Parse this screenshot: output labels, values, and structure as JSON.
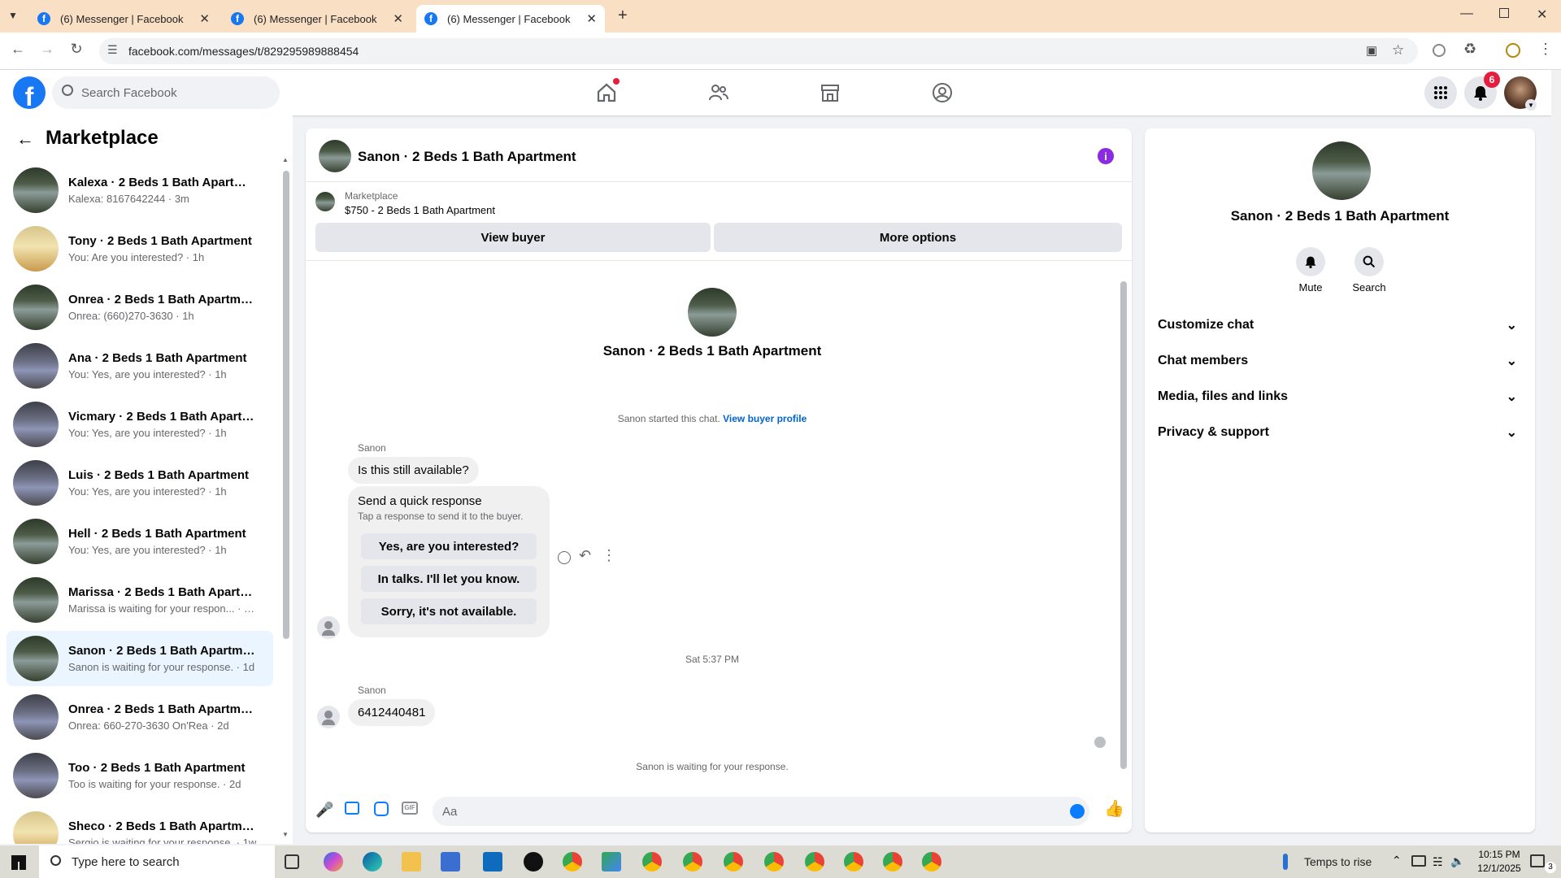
{
  "browser": {
    "tabs": [
      {
        "title": "(6) Messenger | Facebook"
      },
      {
        "title": "(6) Messenger | Facebook"
      },
      {
        "title": "(6) Messenger | Facebook"
      }
    ],
    "url": "facebook.com/messages/t/829295989888454"
  },
  "fb": {
    "search_placeholder": "Search Facebook",
    "notification_count": "6"
  },
  "left": {
    "title": "Marketplace",
    "conversations": [
      {
        "name": "Kalexa · 2 Beds 1 Bath Apartment",
        "sub": "Kalexa: 8167642244 · 3m",
        "img": "a"
      },
      {
        "name": "Tony · 2 Beds 1 Bath Apartment",
        "sub": "You: Are you interested? · 1h",
        "img": "b"
      },
      {
        "name": "Onrea · 2 Beds 1 Bath Apartment",
        "sub": "Onrea: (660)270-3630 · 1h",
        "img": "a"
      },
      {
        "name": "Ana · 2 Beds 1 Bath Apartment",
        "sub": "You: Yes, are you interested? · 1h",
        "img": "c"
      },
      {
        "name": "Vicmary · 2 Beds 1 Bath Apartm...",
        "sub": "You: Yes, are you interested? · 1h",
        "img": "c"
      },
      {
        "name": "Luis · 2 Beds 1 Bath Apartment",
        "sub": "You: Yes, are you interested? · 1h",
        "img": "c"
      },
      {
        "name": "Hell · 2 Beds 1 Bath Apartment",
        "sub": "You: Yes, are you interested? · 1h",
        "img": "a"
      },
      {
        "name": "Marissa · 2 Beds 1 Bath Apartment",
        "sub": "Marissa is waiting for your respon... · 15h",
        "img": "a"
      },
      {
        "name": "Sanon · 2 Beds 1 Bath Apartment",
        "sub": "Sanon is waiting for your response. · 1d",
        "img": "a"
      },
      {
        "name": "Onrea · 2 Beds 1 Bath Apartment",
        "sub": "Onrea: 660-270-3630 On'Rea · 2d",
        "img": "c"
      },
      {
        "name": "Too · 2 Beds 1 Bath Apartment",
        "sub": "Too is waiting for your response. · 2d",
        "img": "c"
      },
      {
        "name": "Sheco · 2 Beds 1 Bath Apartment",
        "sub": "Sergio is waiting for your response. · 1w",
        "img": "b"
      }
    ]
  },
  "chat": {
    "header_title": "Sanon · 2 Beds 1 Bath Apartment",
    "listing_source": "Marketplace",
    "listing_title": "$750 - 2 Beds 1 Bath Apartment",
    "view_buyer": "View buyer",
    "more_options": "More options",
    "profile_name": "Sanon · 2 Beds 1 Bath Apartment",
    "started_text": "Sanon started this chat.",
    "view_buyer_profile": "View buyer profile",
    "sender1": "Sanon",
    "msg1": "Is this still available?",
    "quick_title": "Send a quick response",
    "quick_sub": "Tap a response to send it to the buyer.",
    "quick_replies": [
      "Yes, are you interested?",
      "In talks. I'll let you know.",
      "Sorry, it's not available."
    ],
    "timestamp": "Sat 5:37 PM",
    "sender2": "Sanon",
    "msg2": "6412440481",
    "waiting": "Sanon is waiting for your response.",
    "composer_placeholder": "Aa"
  },
  "right": {
    "name": "Sanon · 2 Beds 1 Bath Apartment",
    "mute": "Mute",
    "search": "Search",
    "sections": [
      "Customize chat",
      "Chat members",
      "Media, files and links",
      "Privacy & support"
    ]
  },
  "taskbar": {
    "search_placeholder": "Type here to search",
    "weather": "Temps to rise",
    "time": "10:15 PM",
    "date": "12/1/2025",
    "notif": "3"
  }
}
